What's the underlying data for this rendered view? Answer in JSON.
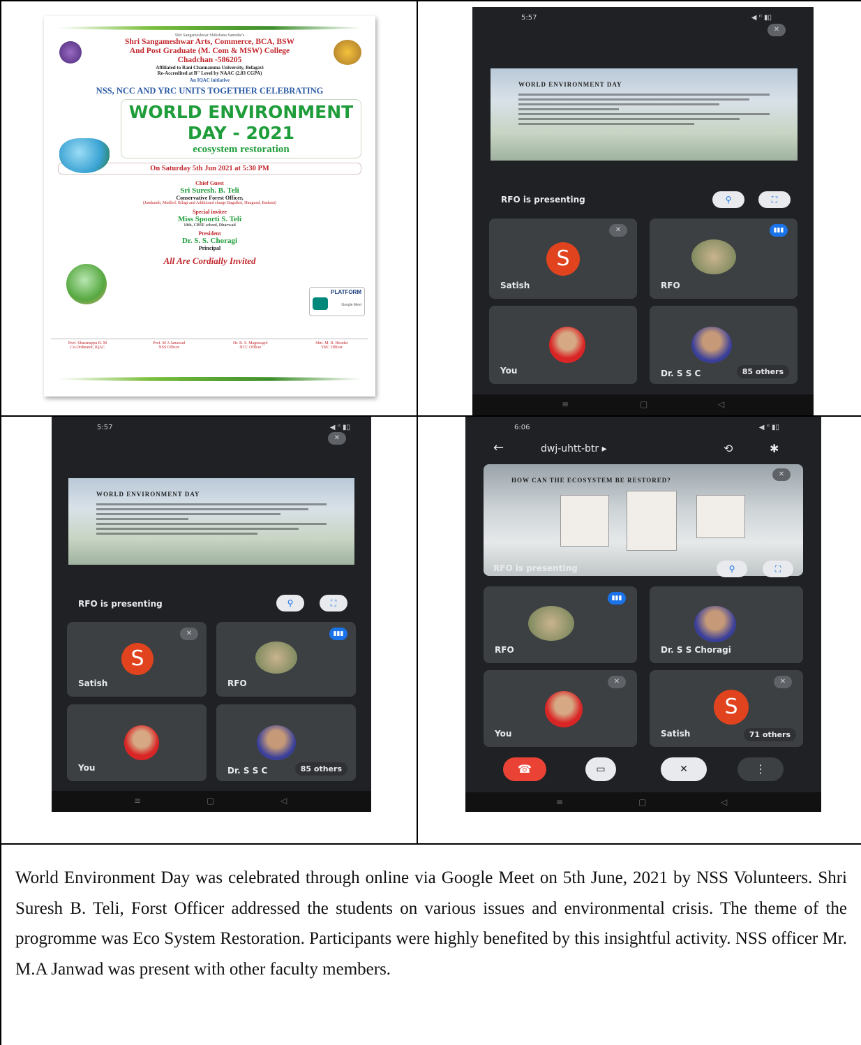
{
  "poster": {
    "university_line": "Shri Sangameshwar Shikshana Samsthe's",
    "college_line1": "Shri Sangameshwar Arts, Commerce, BCA, BSW",
    "college_line2": "And Post Graduate (M. Com & MSW) College",
    "college_line3": "Chadchan -586205",
    "affiliation": "Affiliated to Rani Channamma University, Belagavi",
    "accreditation": "Re-Accredited at B\" Level by NAAC (2.83 CGPA)",
    "iqac": "An IQAC initiative",
    "units_line": "NSS, NCC AND YRC UNITS TOGETHER CELEBRATING",
    "event_title1": "WORLD ENVIRONMENT",
    "event_title2": "DAY - 2021",
    "theme": "ecosystem restoration",
    "date_line": "On Saturday 5th Jun 2021 at 5:30 PM",
    "chief_guest_label": "Chief Guest",
    "chief_guest_name": "Sri Suresh. B. Teli",
    "chief_guest_title": "Conservative Forest Officer,",
    "chief_guest_places": "(Jamkandi, Mudhol, Bilagi and Additional charge Bagalkot, Hungund, Badami)",
    "special_label": "Special invitee",
    "special_name": "Miss Spoorti S. Teli",
    "special_detail": "10th, CBSE school, Dharwad",
    "president_label": "President",
    "president_name": "Dr. S. S. Choragi",
    "president_title": "Principal",
    "platform_label": "PLATFORM",
    "platform_name": "Google Meet",
    "invite_line": "All Are Cordially Invited",
    "footer": [
      {
        "name": "Prof. Sharanappa B. M",
        "role": "Co-Ordinator, IQAC"
      },
      {
        "name": "Prof. M A Janawad",
        "role": "NSS Officer"
      },
      {
        "name": "Dr. R. S. Magunagol",
        "role": "NCC Officer"
      },
      {
        "name": "Shri. M. R. Biradar",
        "role": "YRC Officer"
      }
    ]
  },
  "phone1": {
    "time": "5:57",
    "status_icons": "◀ ʳˡ ▮▯",
    "slide_title": "WORLD ENVIRONMENT DAY",
    "presenting": "RFO is presenting",
    "tiles": [
      {
        "name": "Satish",
        "initial": "S"
      },
      {
        "name": "RFO"
      },
      {
        "name": "You"
      },
      {
        "name": "Dr. S S C",
        "others": "85 others"
      }
    ]
  },
  "phone2": {
    "time": "5:57",
    "slide_title": "WORLD ENVIRONMENT DAY",
    "presenting": "RFO is presenting",
    "tiles": [
      {
        "name": "Satish",
        "initial": "S"
      },
      {
        "name": "RFO"
      },
      {
        "name": "You"
      },
      {
        "name": "Dr. S S C",
        "others": "85 others"
      }
    ]
  },
  "phone3": {
    "time": "6:06",
    "meeting_code": "dwj-uhtt-btr",
    "slide_title": "HOW CAN THE ECOSYSTEM BE RESTORED?",
    "presenting": "RFO is presenting",
    "tiles": [
      {
        "name": "RFO"
      },
      {
        "name": "Dr. S S Choragi"
      },
      {
        "name": "You"
      },
      {
        "name": "Satish",
        "initial": "S",
        "others": "71 others"
      }
    ]
  },
  "caption": "World Environment Day was celebrated through online via Google Meet on 5th June, 2021 by NSS Volunteers. Shri Suresh B. Teli, Forst Officer addressed the students on various issues and environmental crisis. The theme of the progromme was Eco System Restoration. Participants were highly benefited by this insightful activity. NSS officer Mr. M.A Janwad was present with other faculty members.",
  "colors": {
    "accent": "#1a73e8",
    "avatar": "#e0431d",
    "meet_bg": "#202124",
    "tile_bg": "#3c4043"
  }
}
